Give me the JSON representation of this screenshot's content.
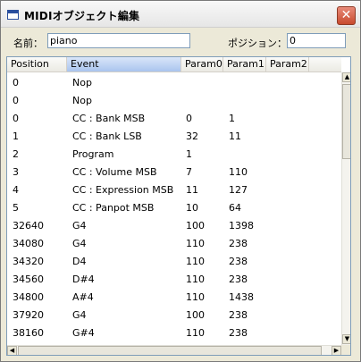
{
  "window": {
    "title": "MIDIオブジェクト編集",
    "close_glyph": "✕"
  },
  "form": {
    "name_label": "名前：",
    "name_value": "piano",
    "position_label": "ポジション：",
    "position_value": "0"
  },
  "table": {
    "columns": [
      "Position",
      "Event",
      "Param0",
      "Param1",
      "Param2"
    ],
    "rows": [
      [
        "0",
        "Nop",
        "",
        "",
        ""
      ],
      [
        "0",
        "Nop",
        "",
        "",
        ""
      ],
      [
        "0",
        "CC : Bank MSB",
        "0",
        "1",
        ""
      ],
      [
        "1",
        "CC : Bank LSB",
        "32",
        "11",
        ""
      ],
      [
        "2",
        "Program",
        "1",
        "",
        ""
      ],
      [
        "3",
        "CC : Volume MSB",
        "7",
        "110",
        ""
      ],
      [
        "4",
        "CC : Expression MSB",
        "11",
        "127",
        ""
      ],
      [
        "5",
        "CC : Panpot MSB",
        "10",
        "64",
        ""
      ],
      [
        "32640",
        "G4",
        "100",
        "1398",
        ""
      ],
      [
        "34080",
        "G4",
        "110",
        "238",
        ""
      ],
      [
        "34320",
        "D4",
        "110",
        "238",
        ""
      ],
      [
        "34560",
        "D#4",
        "110",
        "238",
        ""
      ],
      [
        "34800",
        "A#4",
        "110",
        "1438",
        ""
      ],
      [
        "37920",
        "G4",
        "100",
        "238",
        ""
      ],
      [
        "38160",
        "G#4",
        "110",
        "238",
        ""
      ]
    ]
  },
  "scroll": {
    "up": "▲",
    "down": "▼",
    "left": "◀",
    "right": "▶"
  }
}
